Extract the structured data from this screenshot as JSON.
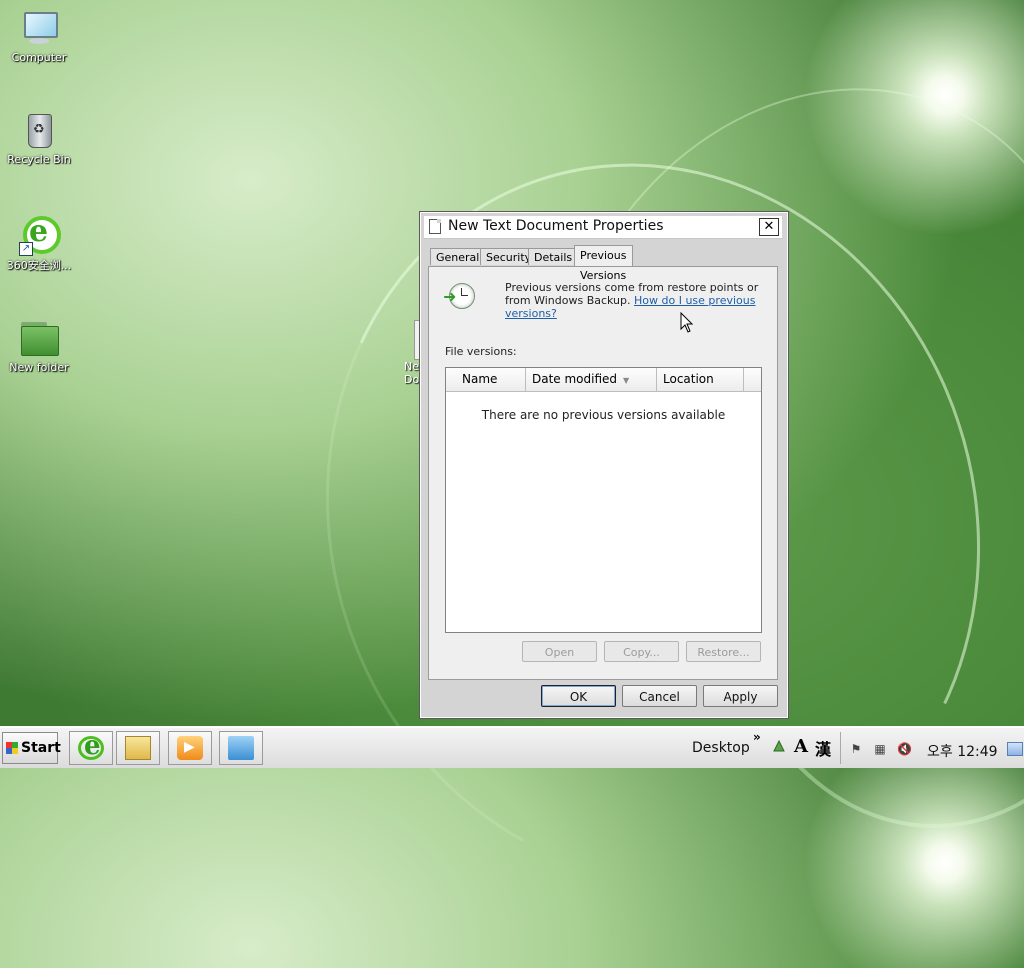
{
  "desktop": {
    "icons": [
      {
        "label": "Computer"
      },
      {
        "label": "Recycle Bin"
      },
      {
        "label": "360安全浏..."
      },
      {
        "label": "New folder"
      }
    ],
    "partial_icon_label": "Ne Do"
  },
  "dialog": {
    "title": "New Text Document Properties",
    "close_label": "✕",
    "tabs": [
      {
        "label": "General"
      },
      {
        "label": "Security"
      },
      {
        "label": "Details"
      },
      {
        "label": "Previous Versions",
        "active": true
      }
    ],
    "info_text": "Previous versions come from restore points or from Windows Backup.",
    "info_link": "How do I use previous versions?",
    "file_versions_label": "File versions:",
    "columns": [
      {
        "label": "Name"
      },
      {
        "label": "Date modified"
      },
      {
        "label": "Location"
      }
    ],
    "empty_message": "There are no previous versions available",
    "action_buttons": {
      "open": "Open",
      "copy": "Copy...",
      "restore": "Restore..."
    },
    "footer_buttons": {
      "ok": "OK",
      "cancel": "Cancel",
      "apply": "Apply"
    }
  },
  "taskbar": {
    "start_label": "Start",
    "desktop_label": "Desktop",
    "toolbar_chevron": "»",
    "ime_mode": "A",
    "ime_hanja": "漢",
    "clock": "오후 12:49"
  }
}
